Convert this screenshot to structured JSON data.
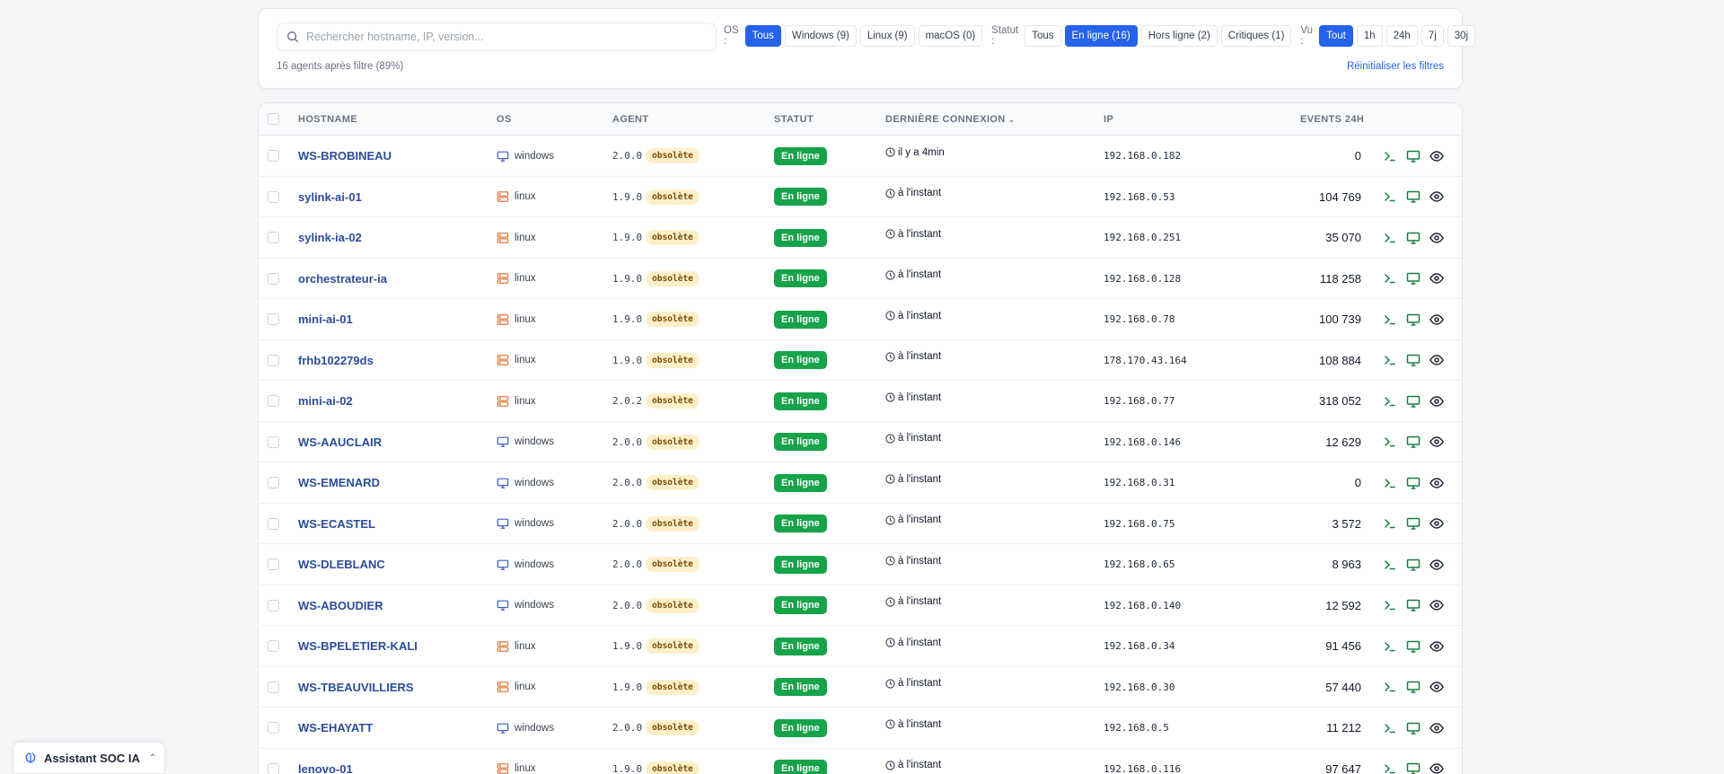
{
  "search": {
    "placeholder": "Rechercher hostname, IP, version..."
  },
  "filters": {
    "os_label": "OS :",
    "os": [
      {
        "label": "Tous",
        "active": true
      },
      {
        "label": "Windows (9)",
        "active": false
      },
      {
        "label": "Linux (9)",
        "active": false
      },
      {
        "label": "macOS (0)",
        "active": false
      }
    ],
    "status_label": "Statut :",
    "status": [
      {
        "label": "Tous",
        "active": false
      },
      {
        "label": "En ligne (16)",
        "active": true
      },
      {
        "label": "Hors ligne (2)",
        "active": false
      },
      {
        "label": "Critiques (1)",
        "active": false
      }
    ],
    "seen_label": "Vu :",
    "seen": [
      {
        "label": "Tout",
        "active": true
      },
      {
        "label": "1h",
        "active": false
      },
      {
        "label": "24h",
        "active": false
      },
      {
        "label": "7j",
        "active": false
      },
      {
        "label": "30j",
        "active": false
      }
    ],
    "count_text": "16 agents après filtre (89%)",
    "reset_label": "Réinitialiser les filtres"
  },
  "table": {
    "headers": {
      "hostname": "HOSTNAME",
      "os": "OS",
      "agent": "AGENT",
      "status": "STATUT",
      "last_connection": "DERNIÈRE CONNEXION",
      "ip": "IP",
      "events": "EVENTS 24H"
    },
    "rows": [
      {
        "hostname": "WS-BROBINEAU",
        "os": "windows",
        "version": "2.0.0",
        "badge": "obsolète",
        "status": "En ligne",
        "last": "il y a 4min",
        "ip": "192.168.0.182",
        "events": "0"
      },
      {
        "hostname": "sylink-ai-01",
        "os": "linux",
        "version": "1.9.0",
        "badge": "obsolète",
        "status": "En ligne",
        "last": "à l'instant",
        "ip": "192.168.0.53",
        "events": "104 769"
      },
      {
        "hostname": "sylink-ia-02",
        "os": "linux",
        "version": "1.9.0",
        "badge": "obsolète",
        "status": "En ligne",
        "last": "à l'instant",
        "ip": "192.168.0.251",
        "events": "35 070"
      },
      {
        "hostname": "orchestrateur-ia",
        "os": "linux",
        "version": "1.9.0",
        "badge": "obsolète",
        "status": "En ligne",
        "last": "à l'instant",
        "ip": "192.168.0.128",
        "events": "118 258"
      },
      {
        "hostname": "mini-ai-01",
        "os": "linux",
        "version": "1.9.0",
        "badge": "obsolète",
        "status": "En ligne",
        "last": "à l'instant",
        "ip": "192.168.0.78",
        "events": "100 739"
      },
      {
        "hostname": "frhb102279ds",
        "os": "linux",
        "version": "1.9.0",
        "badge": "obsolète",
        "status": "En ligne",
        "last": "à l'instant",
        "ip": "178.170.43.164",
        "events": "108 884"
      },
      {
        "hostname": "mini-ai-02",
        "os": "linux",
        "version": "2.0.2",
        "badge": "obsolète",
        "status": "En ligne",
        "last": "à l'instant",
        "ip": "192.168.0.77",
        "events": "318 052"
      },
      {
        "hostname": "WS-AAUCLAIR",
        "os": "windows",
        "version": "2.0.0",
        "badge": "obsolète",
        "status": "En ligne",
        "last": "à l'instant",
        "ip": "192.168.0.146",
        "events": "12 629"
      },
      {
        "hostname": "WS-EMENARD",
        "os": "windows",
        "version": "2.0.0",
        "badge": "obsolète",
        "status": "En ligne",
        "last": "à l'instant",
        "ip": "192.168.0.31",
        "events": "0"
      },
      {
        "hostname": "WS-ECASTEL",
        "os": "windows",
        "version": "2.0.0",
        "badge": "obsolète",
        "status": "En ligne",
        "last": "à l'instant",
        "ip": "192.168.0.75",
        "events": "3 572"
      },
      {
        "hostname": "WS-DLEBLANC",
        "os": "windows",
        "version": "2.0.0",
        "badge": "obsolète",
        "status": "En ligne",
        "last": "à l'instant",
        "ip": "192.168.0.65",
        "events": "8 963"
      },
      {
        "hostname": "WS-ABOUDIER",
        "os": "windows",
        "version": "2.0.0",
        "badge": "obsolète",
        "status": "En ligne",
        "last": "à l'instant",
        "ip": "192.168.0.140",
        "events": "12 592"
      },
      {
        "hostname": "WS-BPELETIER-KALI",
        "os": "linux",
        "version": "1.9.0",
        "badge": "obsolète",
        "status": "En ligne",
        "last": "à l'instant",
        "ip": "192.168.0.34",
        "events": "91 456"
      },
      {
        "hostname": "WS-TBEAUVILLIERS",
        "os": "linux",
        "version": "1.9.0",
        "badge": "obsolète",
        "status": "En ligne",
        "last": "à l'instant",
        "ip": "192.168.0.30",
        "events": "57 440"
      },
      {
        "hostname": "WS-EHAYATT",
        "os": "windows",
        "version": "2.0.0",
        "badge": "obsolète",
        "status": "En ligne",
        "last": "à l'instant",
        "ip": "192.168.0.5",
        "events": "11 212"
      },
      {
        "hostname": "lenovo-01",
        "os": "linux",
        "version": "1.9.0",
        "badge": "obsolète",
        "status": "En ligne",
        "last": "à l'instant",
        "ip": "192.168.0.116",
        "events": "97 647"
      }
    ]
  },
  "assistant": {
    "label": "Assistant SOC IA"
  },
  "colors": {
    "accent": "#2563eb",
    "online": "#16a34a",
    "obsolete_bg": "#fdf0c9",
    "linux_icon": "#e07a3a",
    "windows_icon": "#3b5cc4",
    "action_icon": "#15803d"
  }
}
